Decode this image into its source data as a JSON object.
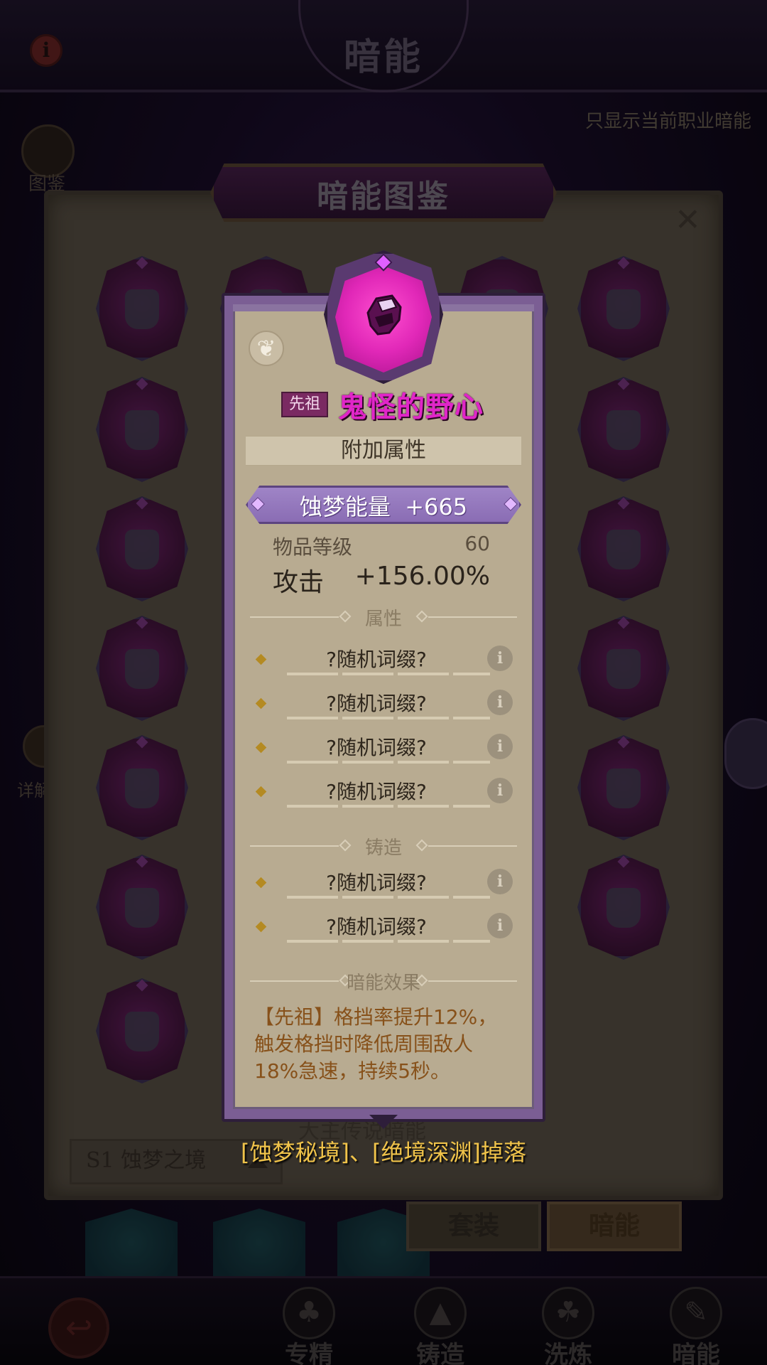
{
  "header": {
    "title": "暗能",
    "info_icon": "info-icon",
    "filter_label": "只显示当前职业暗能"
  },
  "left_rail": {
    "codex_label": "图鉴",
    "detail_label": "详解"
  },
  "codex": {
    "title": "暗能图鉴",
    "close_icon": "close-icon",
    "set_filter": "S1 蚀梦之境",
    "partial_heading": "大主传说暗能",
    "tabs": [
      "套装",
      "暗能"
    ]
  },
  "item": {
    "rarity": "先祖",
    "name": "鬼怪的野心",
    "extra_attr_title": "附加属性",
    "energy_label": "蚀梦能量",
    "energy_value": "+665",
    "level_label": "物品等级",
    "level_value": "60",
    "attack_label": "攻击",
    "attack_value": "+156.00%",
    "attr_section": "属性",
    "attr_affixes": [
      "?随机词缀?",
      "?随机词缀?",
      "?随机词缀?",
      "?随机词缀?"
    ],
    "forge_section": "铸造",
    "forge_affixes": [
      "?随机词缀?",
      "?随机词缀?"
    ],
    "effect_section": "暗能效果",
    "effect_text": "【先祖】格挡率提升12%，触发格挡时降低周围敌人18%急速，持续5秒。",
    "drop_source": "[蚀梦秘境]、[绝境深渊]掉落",
    "accent_color": "#e026c8"
  },
  "bottom_nav": {
    "back_icon": "back-arrow-icon",
    "items": [
      {
        "label": "专精",
        "icon": "tree-icon"
      },
      {
        "label": "铸造",
        "icon": "anvil-icon"
      },
      {
        "label": "洗炼",
        "icon": "triskelion-icon"
      },
      {
        "label": "暗能",
        "icon": "feather-icon"
      }
    ]
  }
}
